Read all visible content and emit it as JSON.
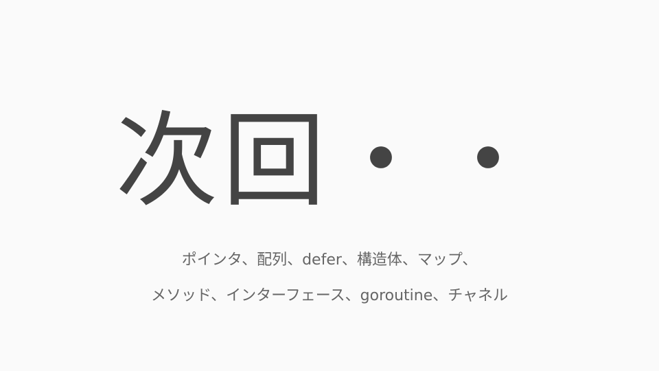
{
  "slide": {
    "title": "次回・・",
    "subtitle_lines": [
      "ポインタ、配列、defer、構造体、マップ、",
      "メソッド、インターフェース、goroutine、チャネル"
    ],
    "colors": {
      "background": "#fafafa",
      "title": "#444444",
      "subtitle": "#666666"
    }
  }
}
